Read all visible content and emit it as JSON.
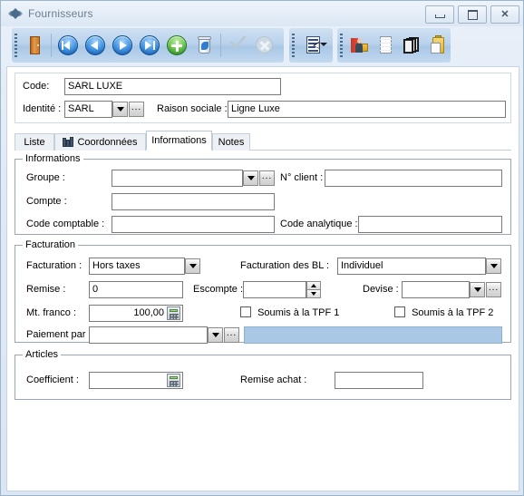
{
  "window": {
    "title": "Fournisseurs",
    "title_icon": "app-diamond-icon",
    "minimize_label": "Minimiser",
    "restore_label": "Restaurer",
    "close_label": "Fermer"
  },
  "toolbar": {
    "groups": [
      {
        "buttons": [
          {
            "name": "exit-button",
            "icon": "door-exit-icon",
            "enabled": true
          },
          {
            "name": "first-record-button",
            "icon": "first-record-icon",
            "enabled": true
          },
          {
            "name": "previous-record-button",
            "icon": "previous-record-icon",
            "enabled": true
          },
          {
            "name": "next-record-button",
            "icon": "next-record-icon",
            "enabled": true
          },
          {
            "name": "last-record-button",
            "icon": "last-record-icon",
            "enabled": true
          },
          {
            "name": "add-record-button",
            "icon": "add-plus-icon",
            "enabled": true
          },
          {
            "name": "delete-record-button",
            "icon": "trash-icon",
            "enabled": true
          },
          {
            "name": "validate-button",
            "icon": "check-icon",
            "enabled": false
          },
          {
            "name": "cancel-button",
            "icon": "cancel-circle-icon",
            "enabled": false
          }
        ]
      },
      {
        "buttons": [
          {
            "name": "list-view-button",
            "icon": "list-document-icon",
            "enabled": true,
            "has_dropdown": true
          }
        ]
      },
      {
        "buttons": [
          {
            "name": "contacts-button",
            "icon": "person-card-icon",
            "enabled": true
          },
          {
            "name": "blank-document-button",
            "icon": "blank-page-icon",
            "enabled": true
          },
          {
            "name": "archives-button",
            "icon": "stacked-books-icon",
            "enabled": true
          },
          {
            "name": "orders-button",
            "icon": "clipboard-folder-icon",
            "enabled": true
          }
        ]
      }
    ]
  },
  "header": {
    "code_label": "Code:",
    "code_value": "SARL LUXE",
    "identite_label": "Identité :",
    "identite_value": "SARL",
    "raison_label": "Raison sociale :",
    "raison_value": "Ligne Luxe"
  },
  "tabs": [
    {
      "label": "Liste",
      "active": false,
      "icon": null
    },
    {
      "label": "Coordonnées",
      "active": false,
      "icon": "building-icon"
    },
    {
      "label": "Informations",
      "active": true,
      "icon": null
    },
    {
      "label": "Notes",
      "active": false,
      "icon": null
    }
  ],
  "informations": {
    "caption": "Informations",
    "groupe_label": "Groupe :",
    "groupe_value": "",
    "nclient_label": "N° client :",
    "nclient_value": "",
    "compte_label": "Compte :",
    "compte_value": "",
    "code_comptable_label": "Code comptable :",
    "code_comptable_value": "",
    "code_analytique_label": "Code analytique :",
    "code_analytique_value": ""
  },
  "facturation": {
    "caption": "Facturation",
    "facturation_label": "Facturation :",
    "facturation_value": "Hors taxes",
    "facturation_bl_label": "Facturation des BL :",
    "facturation_bl_value": "Individuel",
    "remise_label": "Remise :",
    "remise_value": "0",
    "escompte_label": "Escompte :",
    "escompte_value": "",
    "devise_label": "Devise :",
    "devise_value": "",
    "mt_franco_label": "Mt. franco :",
    "mt_franco_value": "100,00",
    "tpf1_label": "Soumis à la TPF 1",
    "tpf1_checked": false,
    "tpf2_label": "Soumis à la TPF 2",
    "tpf2_checked": false,
    "paiement_label": "Paiement par :",
    "paiement_value": ""
  },
  "articles": {
    "caption": "Articles",
    "coefficient_label": "Coefficient :",
    "coefficient_value": "",
    "remise_achat_label": "Remise achat :",
    "remise_achat_value": ""
  },
  "colors": {
    "accent_panel": "#aac8e6",
    "toolbar_gradient_mid": "#b9d2ec",
    "title_text": "#6b7d8f",
    "field_border": "#7a7a7a",
    "group_border": "#9aa6b3"
  }
}
